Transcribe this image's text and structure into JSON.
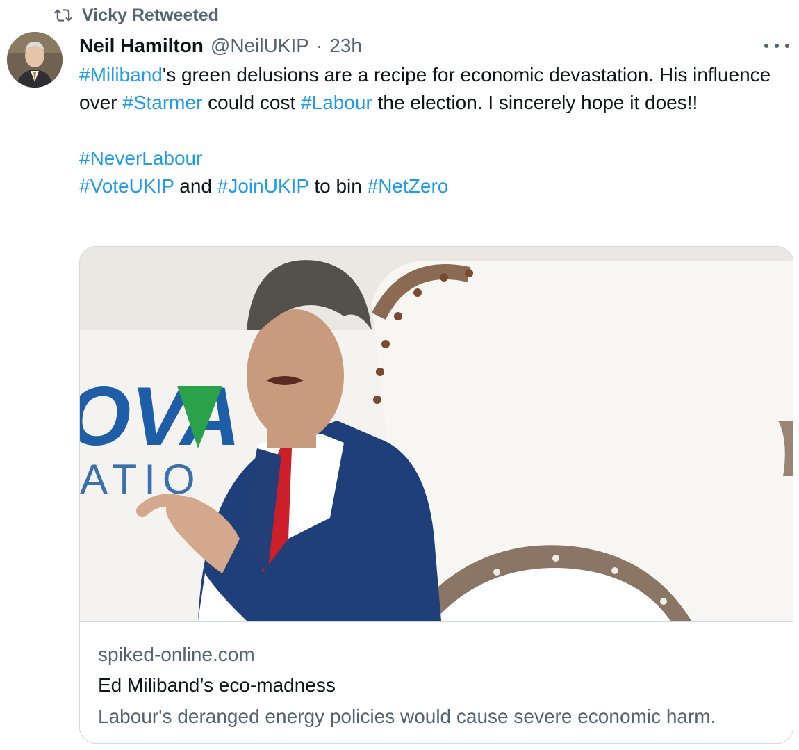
{
  "retweet": {
    "label": "Vicky Retweeted",
    "icon": "retweet-icon"
  },
  "author": {
    "name": "Neil Hamilton",
    "handle": "@NeilUKIP",
    "separator": "·",
    "time": "23h"
  },
  "more_icon": "more-options-icon",
  "tweet": {
    "tag_miliband": "#Miliband",
    "text_1": "'s green delusions are a recipe for economic devastation. His influence over ",
    "tag_starmer": "#Starmer",
    "text_2": " could cost ",
    "tag_labour": "#Labour",
    "text_3": " the election. I sincerely hope it does!!",
    "tag_neverlabour": "#NeverLabour",
    "tag_voteukip": "#VoteUKIP",
    "text_4": " and ",
    "tag_joinukip": "#JoinUKIP",
    "text_5": " to bin ",
    "tag_netzero": "#NetZero"
  },
  "card": {
    "domain": "spiked-online.com",
    "title": "Ed Miliband’s eco-madness",
    "description": "Labour's deranged energy policies would cause severe economic harm.",
    "image_logo_text": "OVA",
    "image_sub_text": "ATIO"
  },
  "colors": {
    "link": "#1d9bf0",
    "secondary": "#536471",
    "border": "#cfd9de",
    "text": "#0f1419"
  }
}
